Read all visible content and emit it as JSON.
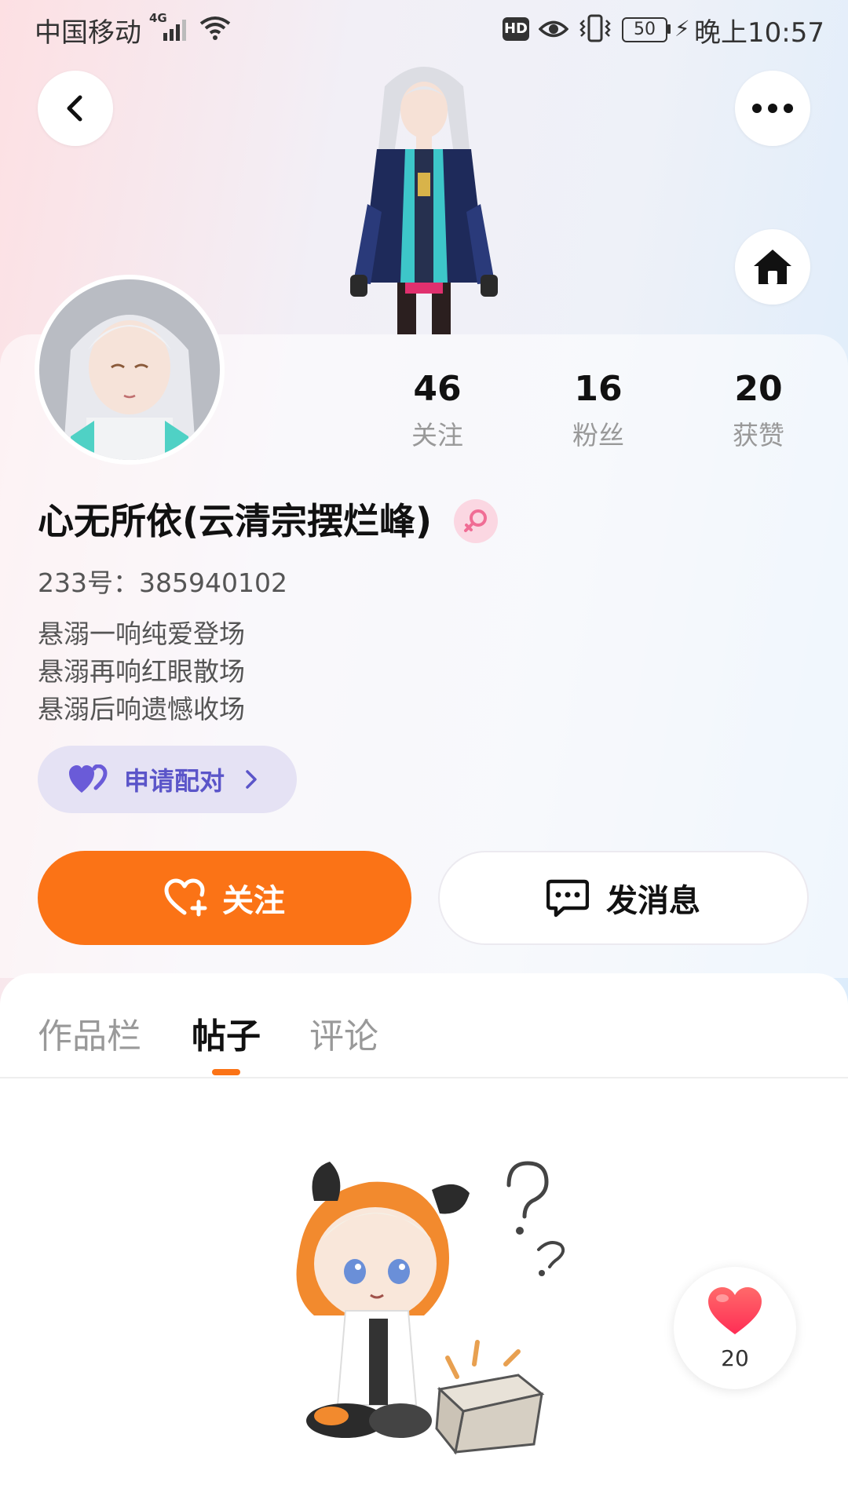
{
  "status_bar": {
    "carrier": "中国移动",
    "network": "4G",
    "battery": "50",
    "time": "晚上10:57",
    "hd_label": "HD"
  },
  "profile": {
    "username": "心无所依(云清宗摆烂峰)",
    "uid_label": "233号：",
    "uid": "385940102",
    "bio_lines": [
      "悬溺一响纯爱登场",
      "悬溺再响红眼散场",
      "悬溺后响遗憾收场"
    ],
    "gender_icon": "female-icon"
  },
  "stats": {
    "following": {
      "value": "46",
      "label": "关注"
    },
    "fans": {
      "value": "16",
      "label": "粉丝"
    },
    "likes": {
      "value": "20",
      "label": "获赞"
    }
  },
  "actions": {
    "pair_label": "申请配对",
    "follow_label": "关注",
    "message_label": "发消息"
  },
  "tabs": [
    {
      "label": "作品栏",
      "active": false
    },
    {
      "label": "帖子",
      "active": true
    },
    {
      "label": "评论",
      "active": false
    }
  ],
  "floating_like": {
    "count": "20"
  },
  "colors": {
    "accent": "#fb7316",
    "pair_bg": "#e5e2f4",
    "pair_text": "#5b55c9",
    "gender_bg": "#fbd7e2"
  }
}
